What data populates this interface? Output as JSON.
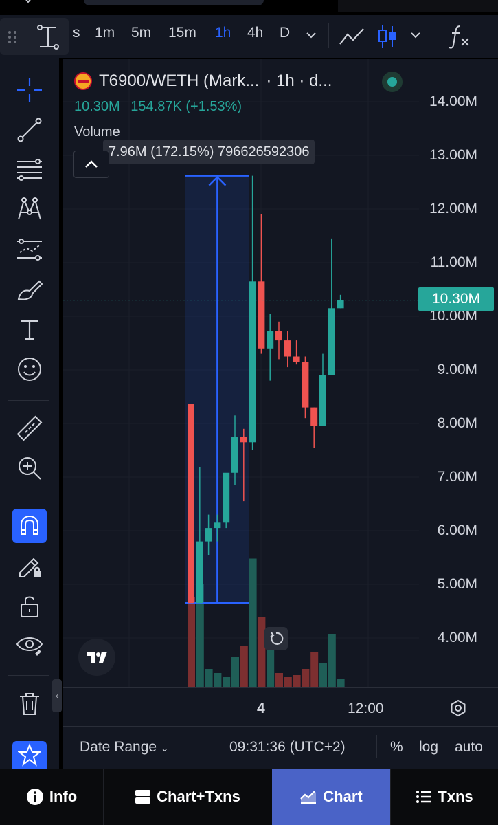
{
  "toolbar": {
    "timeframes": [
      {
        "label": "s",
        "active": false
      },
      {
        "label": "1m",
        "active": false
      },
      {
        "label": "5m",
        "active": false
      },
      {
        "label": "15m",
        "active": false
      },
      {
        "label": "1h",
        "active": true
      },
      {
        "label": "4h",
        "active": false
      },
      {
        "label": "D",
        "active": false
      }
    ],
    "icons": [
      "grip-icon",
      "crosshair-cursor-icon",
      "chevron-down-icon",
      "line-chart-icon",
      "candles-icon",
      "chevron-down-icon",
      "indicators-fx-icon"
    ]
  },
  "sidebar": {
    "tools": [
      "crosshair-icon",
      "trendline-icon",
      "fib-retracement-icon",
      "pattern-icon",
      "prediction-icon",
      "brush-icon",
      "text-icon",
      "emoji-icon",
      "ruler-icon",
      "zoom-in-icon",
      "magnet-icon",
      "lock-drawing-icon",
      "unlock-icon",
      "eye-icon",
      "trash-icon",
      "star-icon"
    ],
    "active_tool": "magnet-icon"
  },
  "chart": {
    "symbol": "T6900/WETH (Mark...",
    "interval": "· 1h · d...",
    "ohlc_price": "10.30M",
    "ohlc_change": "154.87K (+1.53%)",
    "volume_label": "Volume",
    "tooltip": "7.96M (172.15%) 796626592306",
    "last_price": "10.30M",
    "price_axis": [
      "14.00M",
      "13.00M",
      "12.00M",
      "11.00M",
      "10.00M",
      "9.00M",
      "8.00M",
      "7.00M",
      "6.00M",
      "5.00M",
      "4.00M"
    ],
    "time_axis": [
      "4",
      "12:00"
    ],
    "colors": {
      "up": "#26a69a",
      "down": "#ef5350",
      "measure": "#2962ff",
      "background": "#131722"
    }
  },
  "chart_data": {
    "type": "candlestick",
    "ylim": [
      3500000,
      14500000
    ],
    "candles": [
      {
        "o": 8370000,
        "h": 8370000,
        "l": 4650000,
        "c": 4650000
      },
      {
        "o": 4650000,
        "h": 7180000,
        "l": 4650000,
        "c": 5800000
      },
      {
        "o": 5800000,
        "h": 6300000,
        "l": 5550000,
        "c": 6050000
      },
      {
        "o": 6050000,
        "h": 6300000,
        "l": 5800000,
        "c": 6150000
      },
      {
        "o": 6150000,
        "h": 6950000,
        "l": 6050000,
        "c": 7080000
      },
      {
        "o": 7080000,
        "h": 8150000,
        "l": 6850000,
        "c": 7750000
      },
      {
        "o": 7750000,
        "h": 7900000,
        "l": 6550000,
        "c": 7650000
      },
      {
        "o": 7650000,
        "h": 12620000,
        "l": 7500000,
        "c": 10650000
      },
      {
        "o": 10650000,
        "h": 11900000,
        "l": 9300000,
        "c": 9400000
      },
      {
        "o": 9400000,
        "h": 10050000,
        "l": 8800000,
        "c": 9720000
      },
      {
        "o": 9720000,
        "h": 9900000,
        "l": 9200000,
        "c": 9550000
      },
      {
        "o": 9550000,
        "h": 9720000,
        "l": 9050000,
        "c": 9250000
      },
      {
        "o": 9250000,
        "h": 9550000,
        "l": 9100000,
        "c": 9150000
      },
      {
        "o": 9150000,
        "h": 9250000,
        "l": 8100000,
        "c": 8300000
      },
      {
        "o": 8300000,
        "h": 8300000,
        "l": 7550000,
        "c": 7950000
      },
      {
        "o": 7950000,
        "h": 9300000,
        "l": 7950000,
        "c": 8900000
      },
      {
        "o": 8900000,
        "h": 11450000,
        "l": 8900000,
        "c": 10150000
      },
      {
        "o": 10150000,
        "h": 10400000,
        "l": 10150000,
        "c": 10300000
      }
    ],
    "volume_relative": [
      0.88,
      1.0,
      0.18,
      0.14,
      0.1,
      0.3,
      0.4,
      1.25,
      0.68,
      0.58,
      0.14,
      0.1,
      0.12,
      0.18,
      0.34,
      0.24,
      0.52,
      0.08
    ],
    "measurement": {
      "from": 4650000,
      "to": 12620000,
      "label": "7.96M (172.15%) 796626592306"
    }
  },
  "bottom_bar": {
    "date_range": "Date Range",
    "time": "09:31:36 (UTC+2)",
    "percent": "%",
    "log": "log",
    "auto": "auto"
  },
  "nav": {
    "info": "Info",
    "chart_txns": "Chart+Txns",
    "chart": "Chart",
    "txns": "Txns"
  }
}
